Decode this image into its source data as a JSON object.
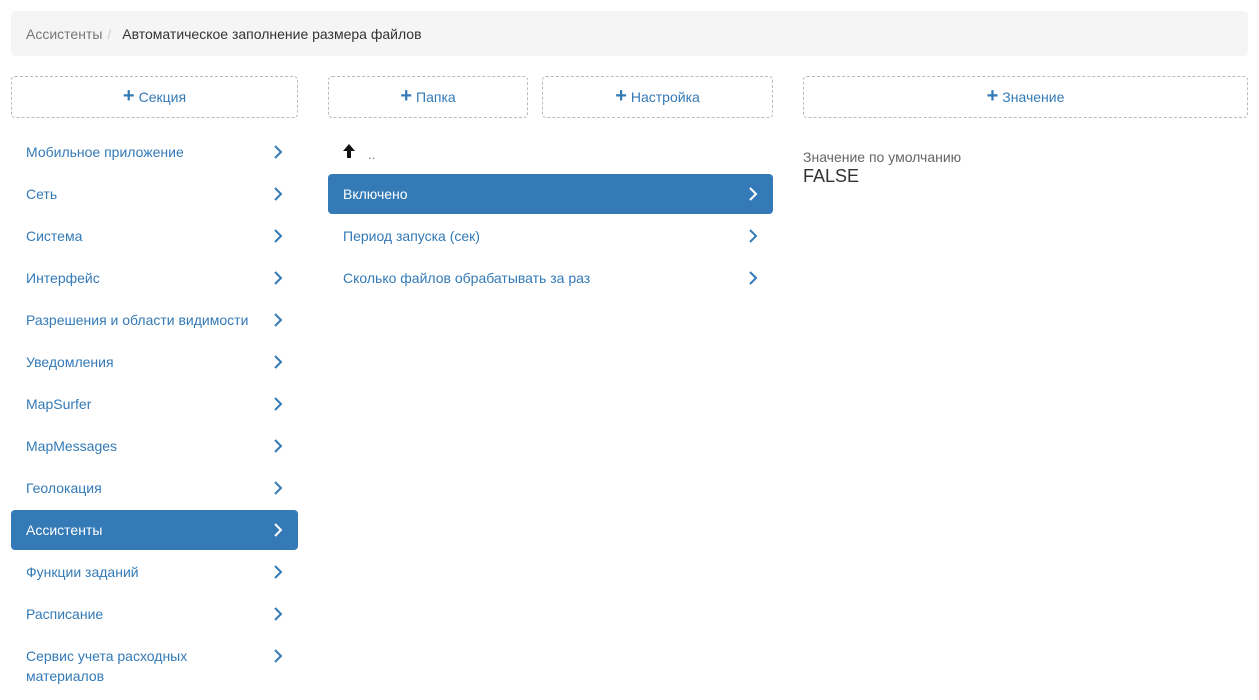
{
  "breadcrumb": {
    "parent": "Ассистенты",
    "separator": "/",
    "current": "Автоматическое заполнение размера файлов"
  },
  "buttons": {
    "section": "Секция",
    "folder": "Папка",
    "setting": "Настройка",
    "value": "Значение"
  },
  "sections": [
    {
      "label": "Мобильное приложение"
    },
    {
      "label": "Сеть"
    },
    {
      "label": "Система"
    },
    {
      "label": "Интерфейс"
    },
    {
      "label": "Разрешения и области видимости"
    },
    {
      "label": "Уведомления"
    },
    {
      "label": "MapSurfer"
    },
    {
      "label": "MapMessages"
    },
    {
      "label": "Геолокация"
    },
    {
      "label": "Ассистенты",
      "active": true
    },
    {
      "label": "Функции заданий"
    },
    {
      "label": "Расписание"
    },
    {
      "label": "Сервис учета расходных материалов"
    }
  ],
  "settings_panel": {
    "up_label": "..",
    "items": [
      {
        "label": "Включено",
        "active": true
      },
      {
        "label": "Период запуска (сек)"
      },
      {
        "label": "Сколько файлов обрабатывать за раз"
      }
    ]
  },
  "value_panel": {
    "default_label": "Значение по умолчанию",
    "default_value": "FALSE"
  },
  "colors": {
    "accent": "#337ab7",
    "breadcrumb_bg": "#f5f5f5"
  }
}
